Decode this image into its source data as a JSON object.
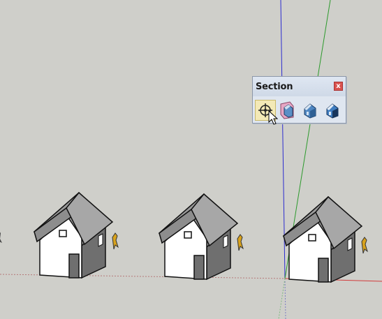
{
  "app": "SketchUp",
  "viewport": {
    "background": "#cfcfca",
    "axes": {
      "red": "#d23b3b",
      "green": "#2c9a2c",
      "blue": "#2c2cd0"
    },
    "models": [
      {
        "name": "house-1",
        "icon": "house-model"
      },
      {
        "name": "house-2",
        "icon": "house-model"
      },
      {
        "name": "house-3",
        "icon": "house-model"
      }
    ]
  },
  "toolbar": {
    "title": "Section",
    "close_label": "x",
    "tools": [
      {
        "name": "section-plane",
        "icon": "section-plane-icon",
        "state": "hover"
      },
      {
        "name": "display-section-planes",
        "icon": "display-section-planes-icon"
      },
      {
        "name": "display-section-cuts",
        "icon": "display-section-cuts-icon"
      },
      {
        "name": "display-section-fill",
        "icon": "display-section-fill-icon"
      }
    ]
  }
}
